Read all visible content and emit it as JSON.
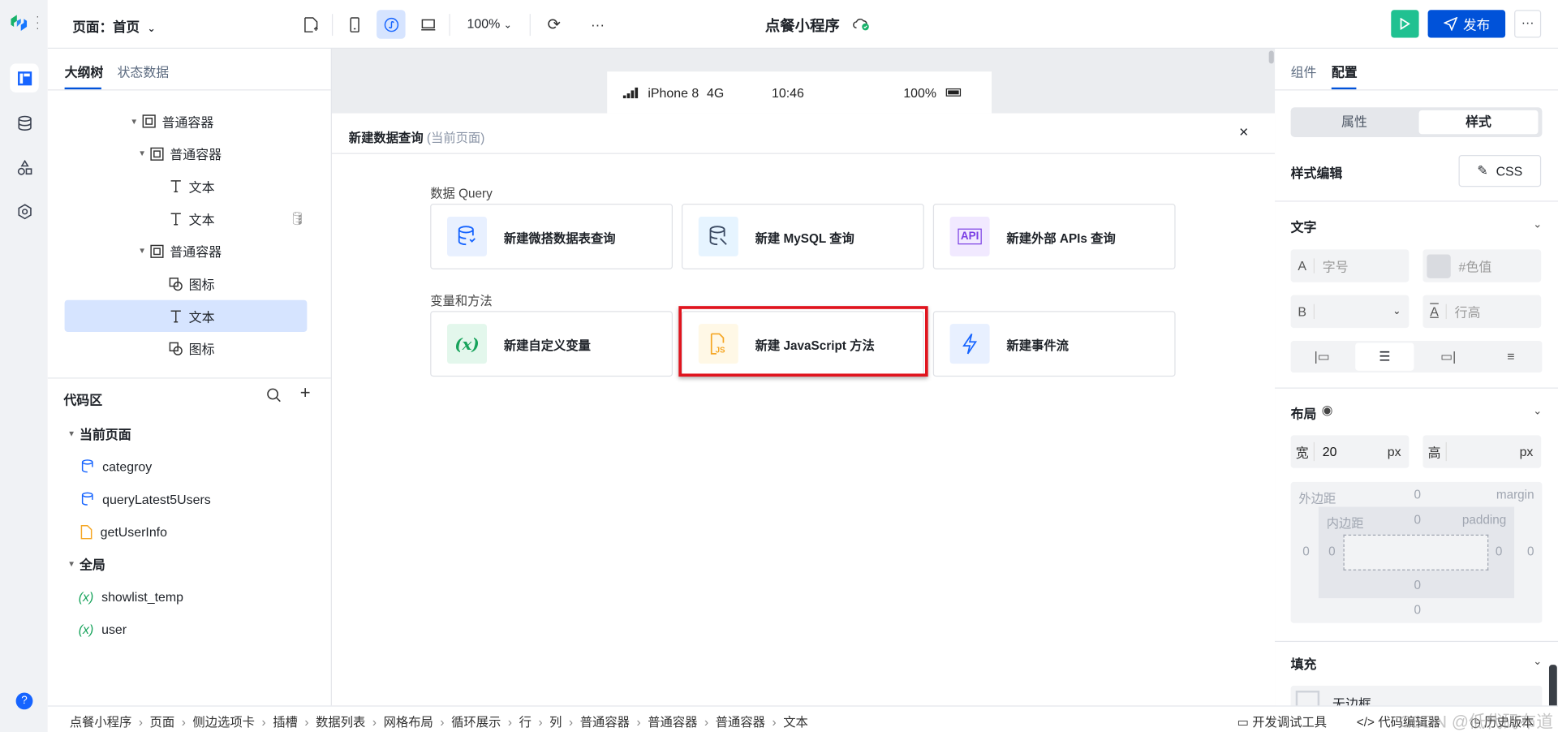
{
  "app": {
    "page_selector": "页面：首页",
    "zoom": "100%",
    "title": "点餐小程序",
    "publish": "发布",
    "accent": "#0052d9",
    "run_color": "#20c191"
  },
  "left": {
    "tabs": [
      "大纲树",
      "状态数据"
    ],
    "tree": [
      {
        "label": "普通容器",
        "icon": "container"
      },
      {
        "label": "普通容器",
        "icon": "container"
      },
      {
        "label": "文本",
        "icon": "text"
      },
      {
        "label": "文本",
        "icon": "text"
      },
      {
        "label": "普通容器",
        "icon": "container"
      },
      {
        "label": "图标",
        "icon": "shapes"
      },
      {
        "label": "文本",
        "icon": "text",
        "selected": true
      },
      {
        "label": "图标",
        "icon": "shapes"
      }
    ],
    "code_title": "代码区",
    "current_page": "当前页面",
    "page_items": [
      "categroy",
      "queryLatest5Users",
      "getUserInfo"
    ],
    "global": "全局",
    "global_items": [
      "showlist_temp",
      "user"
    ]
  },
  "phone": {
    "device": "iPhone 8",
    "network": "4G",
    "time": "10:46",
    "battery": "100%"
  },
  "modal": {
    "title": "新建数据查询",
    "subtitle": "(当前页面)",
    "section1": "数据 Query",
    "section2": "变量和方法",
    "cards1": [
      "新建微搭数据表查询",
      "新建 MySQL 查询",
      "新建外部 APIs 查询"
    ],
    "cards2": [
      "新建自定义变量",
      "新建 JavaScript 方法",
      "新建事件流"
    ],
    "api_icon_text": "API",
    "var_icon_text": "(x)",
    "highlight_color": "#e0141e"
  },
  "right": {
    "tabs": [
      "组件",
      "配置"
    ],
    "seg": [
      "属性",
      "样式"
    ],
    "style_edit": "样式编辑",
    "css_btn": "CSS",
    "text_section": "文字",
    "font_size_prefix": "A",
    "font_size_placeholder": "字号",
    "color_placeholder": "#色值",
    "bold_prefix": "B",
    "line_height_placeholder": "行高",
    "layout_section": "布局",
    "width_label": "宽",
    "width_value": "20",
    "unit": "px",
    "height_label": "高",
    "margin_label": "外边距",
    "margin_en": "margin",
    "padding_label": "内边距",
    "padding_en": "padding",
    "zero": "0",
    "fill_section": "填充",
    "border_none": "无边框"
  },
  "bottom": {
    "breadcrumb": [
      "点餐小程序",
      "页面",
      "侧边选项卡",
      "插槽",
      "数据列表",
      "网格布局",
      "循环展示",
      "行",
      "列",
      "普通容器",
      "普通容器",
      "普通容器",
      "文本"
    ],
    "tools": [
      "开发调试工具",
      "代码编辑器",
      "历史版本"
    ],
    "watermark": "CSDN @低代码布道师"
  }
}
